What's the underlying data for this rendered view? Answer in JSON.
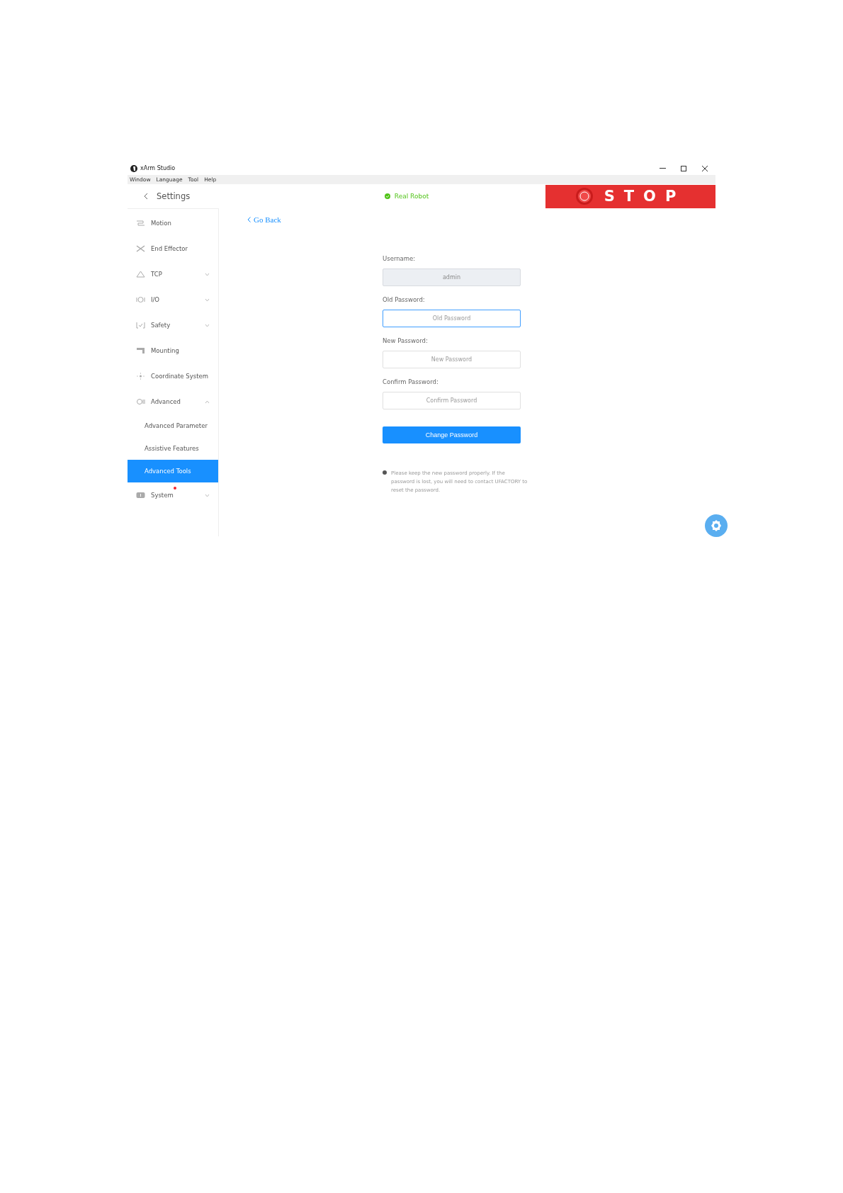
{
  "window": {
    "title": "xArm Studio"
  },
  "menu": [
    "Window",
    "Language",
    "Tool",
    "Help"
  ],
  "header": {
    "title": "Settings",
    "status": "Real Robot",
    "stop": "STOP"
  },
  "sidebar": {
    "items": [
      {
        "label": "Motion",
        "selected": false
      },
      {
        "label": "End Effector",
        "selected": false
      },
      {
        "label": "TCP",
        "selected": false,
        "expanded": false
      },
      {
        "label": "I/O",
        "selected": false,
        "expanded": false
      },
      {
        "label": "Safety",
        "selected": false,
        "expanded": false
      },
      {
        "label": "Mounting",
        "selected": false
      },
      {
        "label": "Coordinate System",
        "selected": false
      },
      {
        "label": "Advanced",
        "selected": false,
        "expanded": true,
        "children": [
          {
            "label": "Advanced Parameter",
            "selected": false
          },
          {
            "label": "Assistive Features",
            "selected": false
          },
          {
            "label": "Advanced Tools",
            "selected": true
          }
        ]
      },
      {
        "label": "System",
        "selected": false,
        "expanded": false,
        "notification": true
      }
    ]
  },
  "form": {
    "go_back": "Go Back",
    "fields": [
      {
        "label": "Username:",
        "value": "admin",
        "disabled": true,
        "focused": false
      },
      {
        "label": "Old Password:",
        "placeholder": "Old Password",
        "disabled": false,
        "focused": true
      },
      {
        "label": "New Password:",
        "placeholder": "New Password",
        "disabled": false,
        "focused": false
      },
      {
        "label": "Confirm Password:",
        "placeholder": "Confirm Password",
        "disabled": false,
        "focused": false
      }
    ],
    "button": "Change Password",
    "note": "Please keep the new password properly. If the password is lost, you will need to contact UFACTORY to reset the password."
  }
}
